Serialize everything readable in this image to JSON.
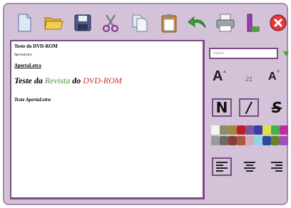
{
  "toolbar": {
    "buttons": [
      {
        "name": "new-document-icon"
      },
      {
        "name": "open-folder-icon"
      },
      {
        "name": "save-disk-icon"
      },
      {
        "name": "cut-scissors-icon"
      },
      {
        "name": "copy-icon"
      },
      {
        "name": "paste-clipboard-icon"
      },
      {
        "name": "undo-arrow-icon"
      },
      {
        "name": "print-icon"
      },
      {
        "name": "logo-l-icon"
      },
      {
        "name": "close-icon"
      }
    ]
  },
  "editor": {
    "line1": "Teste do DVD-ROM",
    "line2": "ApertaLetra",
    "line3": "ApertaLetra",
    "line4": {
      "part1": "Teste da ",
      "part2": "Revista",
      "part3": " do ",
      "part4": "DVD-ROM"
    },
    "line5": "Teste ApertaLetra"
  },
  "format_panel": {
    "font_name": "Impact",
    "font_size": "21",
    "bold_label": "N",
    "italic_label": "/",
    "strike_label": "S",
    "increase_label": "A",
    "decrease_label": "A",
    "colors": [
      "#f4f4f4",
      "#8a8c6c",
      "#a08a3c",
      "#c21d2d",
      "#7a55a0",
      "#3a3fa8",
      "#e2e046",
      "#48b24a",
      "#c02da0",
      "#9a9a9a",
      "#6a6a6a",
      "#86403c",
      "#a85a40",
      "#d8a8b8",
      "#92d4e8",
      "#304a9a",
      "#6a8030",
      "#a050b8"
    ]
  }
}
